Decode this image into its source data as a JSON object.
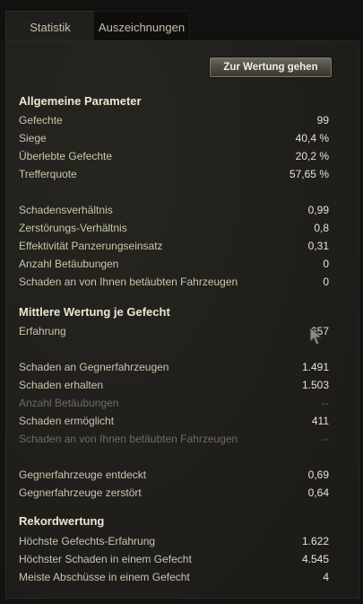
{
  "tabs": {
    "statistik": "Statistik",
    "auszeichnungen": "Auszeichnungen"
  },
  "rating_button": "Zur Wertung gehen",
  "general": {
    "title": "Allgemeine Parameter",
    "rows": [
      {
        "label": "Gefechte",
        "value": "99"
      },
      {
        "label": "Siege",
        "value": "40,4 %"
      },
      {
        "label": "Überlebte Gefechte",
        "value": "20,2 %"
      },
      {
        "label": "Trefferquote",
        "value": "57,65 %"
      },
      {
        "label": "Schadensverhältnis",
        "value": "0,99"
      },
      {
        "label": "Zerstörungs-Verhältnis",
        "value": "0,8"
      },
      {
        "label": "Effektivität Panzerungseinsatz",
        "value": "0,31"
      },
      {
        "label": "Anzahl Betäubungen",
        "value": "0"
      },
      {
        "label": "Schaden an von Ihnen betäubten Fahrzeugen",
        "value": "0"
      }
    ]
  },
  "average": {
    "title": "Mittlere Wertung je Gefecht",
    "rows": [
      {
        "label": "Erfahrung",
        "value": "657"
      },
      {
        "label": "Schaden an Gegnerfahrzeugen",
        "value": "1.491"
      },
      {
        "label": "Schaden erhalten",
        "value": "1.503"
      },
      {
        "label": "Anzahl Betäubungen",
        "value": "--"
      },
      {
        "label": "Schaden ermöglicht",
        "value": "411"
      },
      {
        "label": "Schaden an von Ihnen betäubten Fahrzeugen",
        "value": "--"
      },
      {
        "label": "Gegnerfahrzeuge entdeckt",
        "value": "0,69"
      },
      {
        "label": "Gegnerfahrzeuge zerstört",
        "value": "0,64"
      }
    ]
  },
  "records": {
    "title": "Rekordwertung",
    "rows": [
      {
        "label": "Höchste Gefechts-Erfahrung",
        "value": "1.622"
      },
      {
        "label": "Höchster Schaden in einem Gefecht",
        "value": "4.545"
      },
      {
        "label": "Meiste Abschüsse in einem Gefecht",
        "value": "4"
      }
    ]
  },
  "icons": {
    "cursor": "mouse-pointer-icon"
  }
}
